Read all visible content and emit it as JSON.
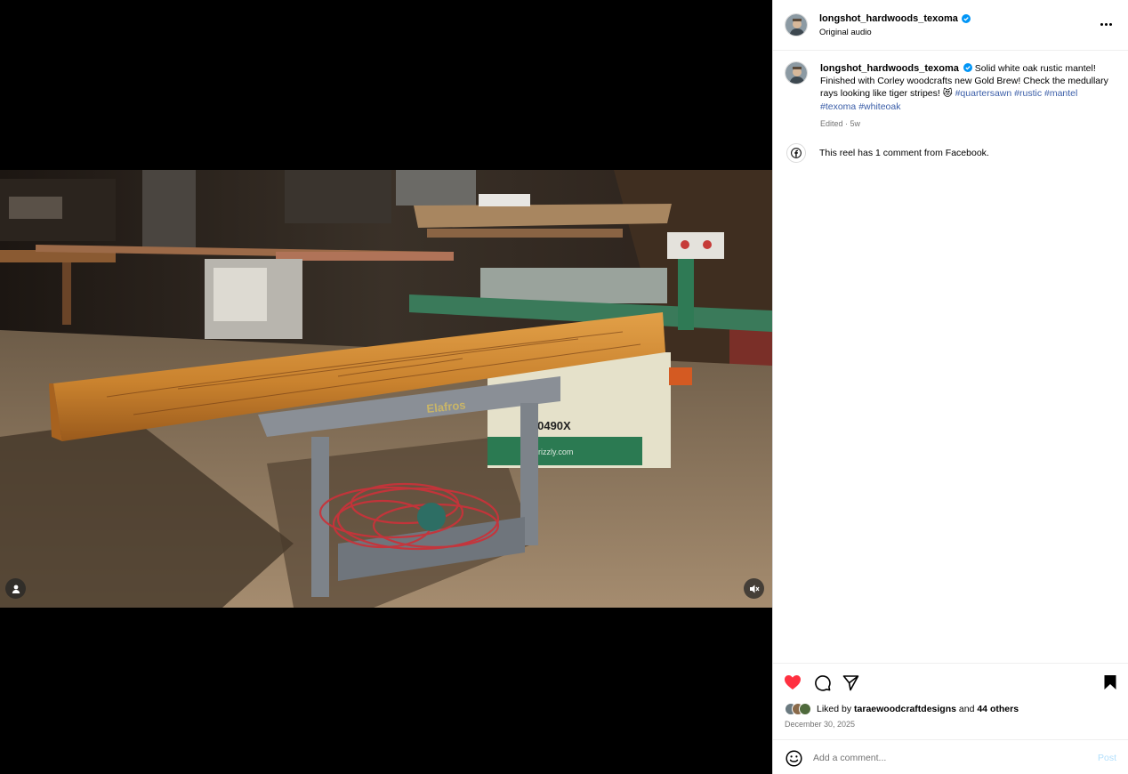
{
  "post": {
    "username": "longshot_hardwoods_texoma",
    "audio_label": "Original audio",
    "caption_text": "Solid white oak rustic mantel! Finished with Corley woodcrafts new Gold Brew! Check the medullary rays looking like tiger stripes! 😻 ",
    "hashtags": [
      "#quartersawn",
      "#rustic",
      "#mantel",
      "#texoma",
      "#whiteoak"
    ],
    "caption_meta": "Edited · 5w",
    "facebook_note": "This reel has 1 comment from Facebook."
  },
  "media": {
    "cart_brand": "Elafros",
    "machine_model": "G0490X",
    "machine_brand": "grizzly.com"
  },
  "engagement": {
    "liked_prefix": "Liked by ",
    "liked_user": "taraewoodcraftdesigns",
    "liked_and": " and ",
    "liked_others": "44 others",
    "date": "December 30, 2025"
  },
  "comment_bar": {
    "placeholder": "Add a comment...",
    "post_label": "Post"
  },
  "colors": {
    "like_red": "#ff3040",
    "hashtag_blue": "#3b5ea8",
    "post_disabled": "#b2dffc",
    "secondary_text": "#737373"
  }
}
